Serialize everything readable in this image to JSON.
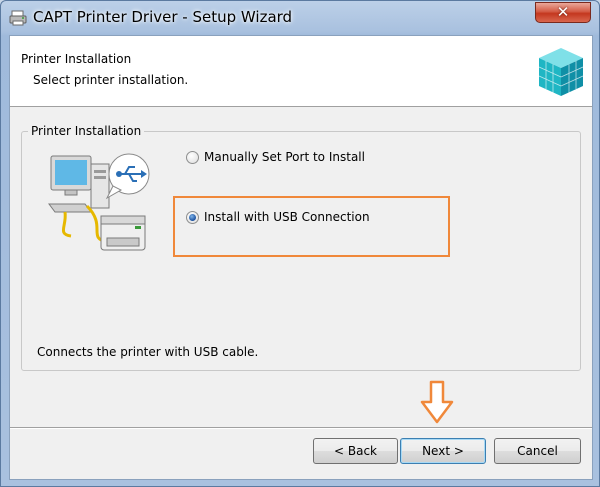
{
  "window": {
    "title": "CAPT Printer Driver - Setup Wizard",
    "close_label": "✕"
  },
  "header": {
    "title": "Printer Installation",
    "subtitle": "Select printer installation."
  },
  "group": {
    "legend": "Printer Installation",
    "options": [
      {
        "label": "Manually Set Port to Install",
        "checked": false
      },
      {
        "label": "Install with USB Connection",
        "checked": true
      }
    ],
    "description": "Connects the printer with USB cable."
  },
  "buttons": {
    "back": "< Back",
    "next": "Next >",
    "cancel": "Cancel"
  },
  "colors": {
    "highlight": "#f0883a",
    "arrow": "#f0883a"
  }
}
